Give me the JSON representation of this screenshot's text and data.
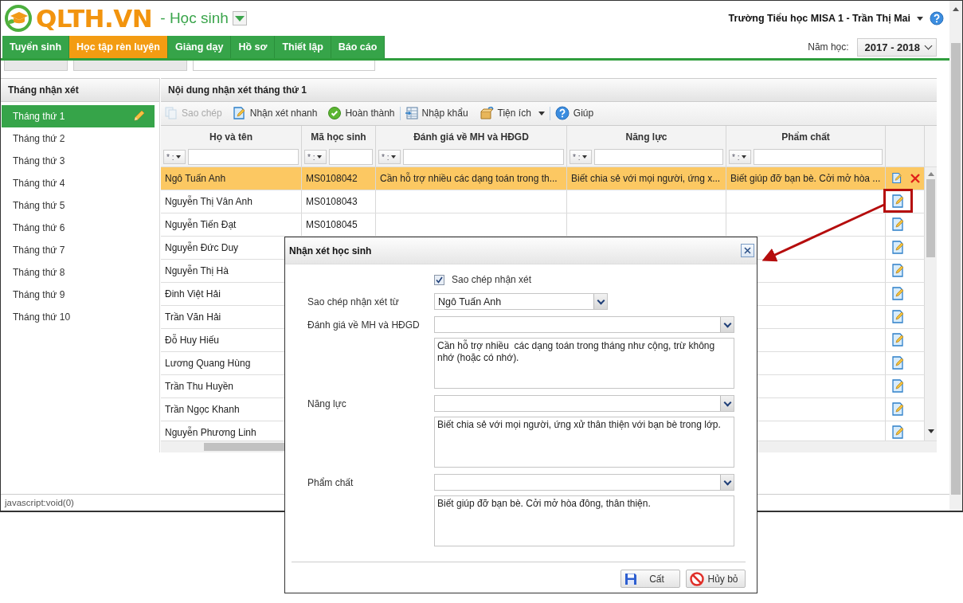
{
  "app": {
    "logo": "QLTH.VN",
    "module": "- Học sinh",
    "user": "Trường Tiểu học MISA 1 - Trần Thị Mai"
  },
  "nav_tabs": [
    {
      "label": "Tuyển sinh",
      "selected": false
    },
    {
      "label": "Học tập rèn luyện",
      "selected": true
    },
    {
      "label": "Giảng dạy",
      "selected": false
    },
    {
      "label": "Hồ sơ",
      "selected": false
    },
    {
      "label": "Thiết lập",
      "selected": false
    },
    {
      "label": "Báo cáo",
      "selected": false
    }
  ],
  "school_year": {
    "label": "Năm học:",
    "value": "2017 - 2018"
  },
  "sub_tabs": [
    {
      "selected": false
    },
    {
      "selected": false
    },
    {
      "selected": true
    }
  ],
  "sidebar": {
    "title": "Tháng nhận xét",
    "items": [
      {
        "label": "Tháng thứ 1",
        "selected": true
      },
      {
        "label": "Tháng thứ 2",
        "selected": false
      },
      {
        "label": "Tháng thứ 3",
        "selected": false
      },
      {
        "label": "Tháng thứ 4",
        "selected": false
      },
      {
        "label": "Tháng thứ 5",
        "selected": false
      },
      {
        "label": "Tháng thứ 6",
        "selected": false
      },
      {
        "label": "Tháng thứ 7",
        "selected": false
      },
      {
        "label": "Tháng thứ 8",
        "selected": false
      },
      {
        "label": "Tháng thứ 9",
        "selected": false
      },
      {
        "label": "Tháng thứ 10",
        "selected": false
      }
    ]
  },
  "content": {
    "title": "Nội dung nhận xét tháng thứ 1",
    "toolbar": [
      {
        "label": "Sao chép",
        "disabled": true
      },
      {
        "label": "Nhận xét nhanh",
        "disabled": false
      },
      {
        "label": "Hoàn thành",
        "disabled": false
      },
      {
        "label": "Nhập khẩu",
        "disabled": false
      },
      {
        "label": "Tiện ích",
        "disabled": false
      },
      {
        "label": "Giúp",
        "disabled": false
      }
    ],
    "columns": [
      {
        "label": "Họ và tên",
        "filter_operator": "* :"
      },
      {
        "label": "Mã học sinh",
        "filter_operator": "* :"
      },
      {
        "label": "Đánh giá về MH và HĐGD",
        "filter_operator": "* :"
      },
      {
        "label": "Năng lực",
        "filter_operator": "* :"
      },
      {
        "label": "Phẩm chất",
        "filter_operator": "* :"
      }
    ],
    "rows": [
      {
        "cells": [
          "Ngô Tuấn Anh",
          "MS0108042",
          "Cần hỗ trợ nhiều các dạng toán trong th...",
          "Biết chia sẻ với mọi người, ứng x...",
          "Biết giúp đỡ bạn bè. Cởi mở hòa ..."
        ],
        "selected": true,
        "deletable": true
      },
      {
        "cells": [
          "Nguyễn Thị Vân Anh",
          "MS0108043"
        ],
        "selected": false,
        "deletable": false
      },
      {
        "cells": [
          "Nguyễn Tiến Đạt",
          "MS0108045"
        ],
        "selected": false,
        "deletable": false
      },
      {
        "cells": [
          "Nguyễn Đức Duy"
        ],
        "selected": false,
        "deletable": false
      },
      {
        "cells": [
          "Nguyễn Thị Hà"
        ],
        "selected": false,
        "deletable": false
      },
      {
        "cells": [
          "Đinh Việt Hải"
        ],
        "selected": false,
        "deletable": false
      },
      {
        "cells": [
          "Trần Văn Hải"
        ],
        "selected": false,
        "deletable": false
      },
      {
        "cells": [
          "Đỗ Huy Hiếu"
        ],
        "selected": false,
        "deletable": false
      },
      {
        "cells": [
          "Lương Quang Hùng"
        ],
        "selected": false,
        "deletable": false
      },
      {
        "cells": [
          "Trần Thu Huyền"
        ],
        "selected": false,
        "deletable": false
      },
      {
        "cells": [
          "Trần Ngọc Khanh"
        ],
        "selected": false,
        "deletable": false
      },
      {
        "cells": [
          "Nguyễn Phương Linh"
        ],
        "selected": false,
        "deletable": false
      }
    ]
  },
  "status_bar": "javascript:void(0)",
  "dialog": {
    "title": "Nhận xét học sinh",
    "copy_checkbox": {
      "label": "Sao chép nhận xét",
      "checked": true
    },
    "copy_from": {
      "label": "Sao chép nhận xét từ",
      "value": "Ngô Tuấn Anh"
    },
    "fields": [
      {
        "label": "Đánh giá về MH và HĐGD",
        "text": "Cần hỗ trợ nhiều  các dạng toán trong tháng như cộng, trừ không nhớ (hoặc có nhớ)."
      },
      {
        "label": "Năng lực",
        "text": "Biết chia sẻ với mọi người, ứng xử thân thiện với bạn bè trong lớp."
      },
      {
        "label": "Phẩm chất",
        "text": "Biết giúp đỡ bạn bè. Cởi mở hòa đông, thân thiện."
      }
    ],
    "buttons": [
      "Cất",
      "Hủy bỏ"
    ]
  }
}
